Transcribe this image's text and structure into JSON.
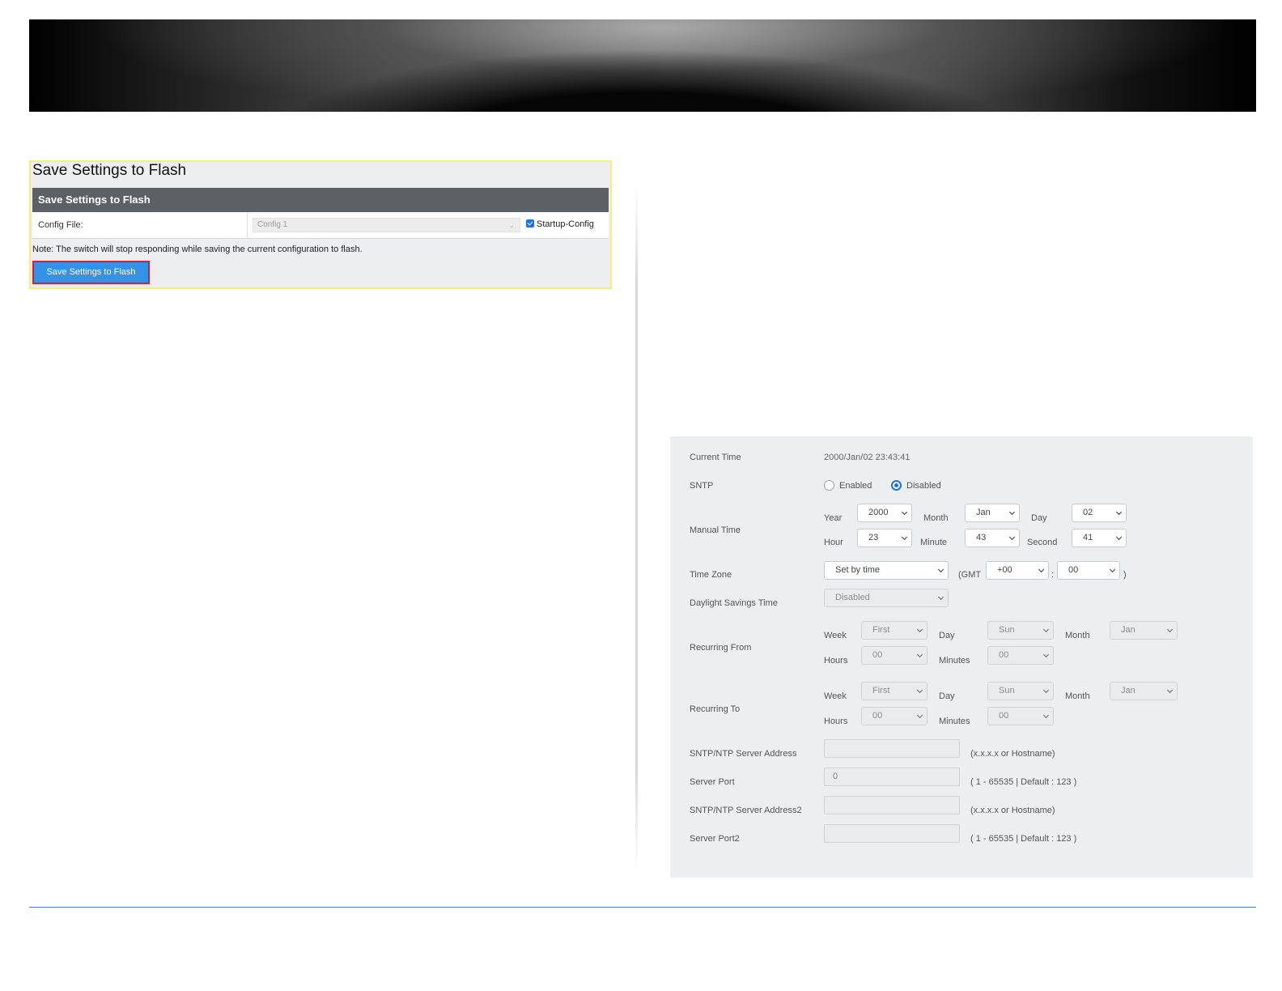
{
  "save_flash": {
    "page_title": "Save Settings to Flash",
    "section_title": "Save Settings to Flash",
    "config_label": "Config File:",
    "config_value": "Config 1",
    "startup_label": "Startup-Config",
    "startup_checked": true,
    "note": "Note: The switch will stop responding while saving the current configuration to flash.",
    "save_button": "Save Settings to Flash"
  },
  "time": {
    "current_time_label": "Current Time",
    "current_time_value": "2000/Jan/02 23:43:41",
    "sntp_label": "SNTP",
    "sntp_enabled": "Enabled",
    "sntp_disabled": "Disabled",
    "sntp_selected": "Disabled",
    "manual_time_label": "Manual Time",
    "year_label": "Year",
    "year": "2000",
    "month_label": "Month",
    "month": "Jan",
    "day_label": "Day",
    "day": "02",
    "hour_label": "Hour",
    "hour": "23",
    "minute_label": "Minute",
    "minute": "43",
    "second_label": "Second",
    "second": "41",
    "timezone_label": "Time Zone",
    "timezone_value": "Set by time",
    "gmt_open": "(GMT",
    "gmt_hours": "+00",
    "gmt_colon": ":",
    "gmt_minutes": "00",
    "gmt_close": ")",
    "dst_label": "Daylight Savings Time",
    "dst_value": "Disabled",
    "recurring_from_label": "Recurring From",
    "recurring_to_label": "Recurring To",
    "week_label": "Week",
    "day_of_week_label": "Day",
    "rec_month_label": "Month",
    "hours_label": "Hours",
    "minutes_label": "Minutes",
    "from": {
      "week": "First",
      "day": "Sun",
      "month": "Jan",
      "hours": "00",
      "minutes": "00"
    },
    "to": {
      "week": "First",
      "day": "Sun",
      "month": "Jan",
      "hours": "00",
      "minutes": "00"
    },
    "server1_label": "SNTP/NTP Server Address",
    "server1_value": "",
    "server1_hint": "(x.x.x.x or Hostname)",
    "port1_label": "Server Port",
    "port1_value": "0",
    "port1_hint": "( 1 - 65535 | Default : 123 )",
    "server2_label": "SNTP/NTP Server Address2",
    "server2_value": "",
    "server2_hint": "(x.x.x.x or Hostname)",
    "port2_label": "Server Port2",
    "port2_value": "",
    "port2_hint": "( 1 - 65535 | Default : 123 )"
  },
  "colors": {
    "accent": "#1a73e8",
    "button_bg": "#3493e6",
    "highlight_border": "#e02121",
    "panel_outline": "#f3ee7a",
    "section_header": "#5c6166",
    "footer_line": "#4d7fc4"
  }
}
